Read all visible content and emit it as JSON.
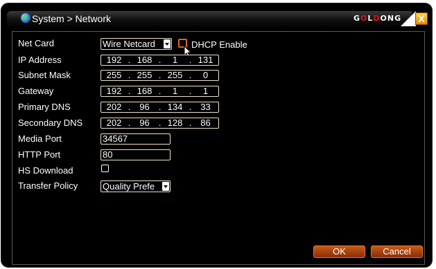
{
  "window": {
    "title": "System > Network",
    "logo": "GOLDONG",
    "close_label": "X"
  },
  "form": {
    "net_card": {
      "label": "Net Card",
      "value": "Wire Netcard"
    },
    "dhcp": {
      "label": "DHCP Enable",
      "checked": false
    },
    "ip_address": {
      "label": "IP Address",
      "octets": [
        "192",
        "168",
        "1",
        "131"
      ]
    },
    "subnet_mask": {
      "label": "Subnet Mask",
      "octets": [
        "255",
        "255",
        "255",
        "0"
      ]
    },
    "gateway": {
      "label": "Gateway",
      "octets": [
        "192",
        "168",
        "1",
        "1"
      ]
    },
    "primary_dns": {
      "label": "Primary DNS",
      "octets": [
        "202",
        "96",
        "134",
        "33"
      ]
    },
    "secondary_dns": {
      "label": "Secondary DNS",
      "octets": [
        "202",
        "96",
        "128",
        "86"
      ]
    },
    "media_port": {
      "label": "Media Port",
      "value": "34567"
    },
    "http_port": {
      "label": "HTTP Port",
      "value": "80"
    },
    "hs_download": {
      "label": "HS Download",
      "checked": false
    },
    "transfer_policy": {
      "label": "Transfer Policy",
      "value": "Quality Prefe"
    }
  },
  "buttons": {
    "ok": "OK",
    "cancel": "Cancel"
  },
  "colors": {
    "accent": "#e0651a",
    "field_border": "#f0e2c8",
    "button": "#a84010"
  }
}
